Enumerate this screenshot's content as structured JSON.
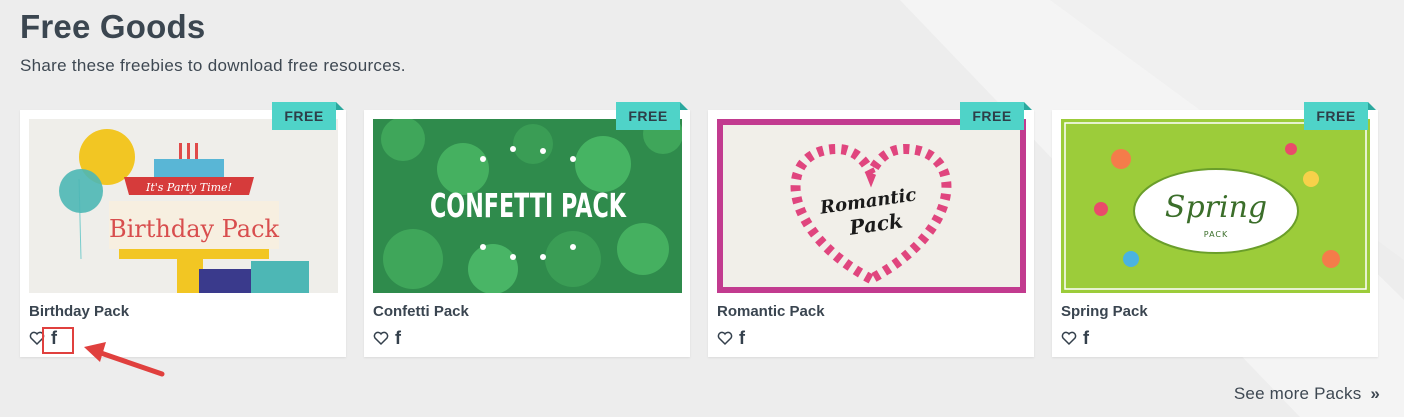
{
  "header": {
    "title": "Free Goods",
    "subtitle": "Share these freebies to download free resources."
  },
  "cards": [
    {
      "title": "Birthday Pack",
      "badge": "FREE",
      "thumb_text_1": "It's Party Time!",
      "thumb_text_2": "Birthday Pack"
    },
    {
      "title": "Confetti Pack",
      "badge": "FREE",
      "thumb_text": "CONFETTI PACK"
    },
    {
      "title": "Romantic Pack",
      "badge": "FREE",
      "thumb_text_1": "Romantic",
      "thumb_text_2": "Pack"
    },
    {
      "title": "Spring Pack",
      "badge": "FREE",
      "thumb_text_1": "Spring",
      "thumb_text_2": "PACK"
    }
  ],
  "actions": {
    "like_icon": "heart-icon",
    "share_icon": "f"
  },
  "see_more": "See more Packs",
  "see_more_icon": "»",
  "colors": {
    "badge": "#4fd3c8",
    "annotation": "#e0403e",
    "text": "#34404c"
  }
}
